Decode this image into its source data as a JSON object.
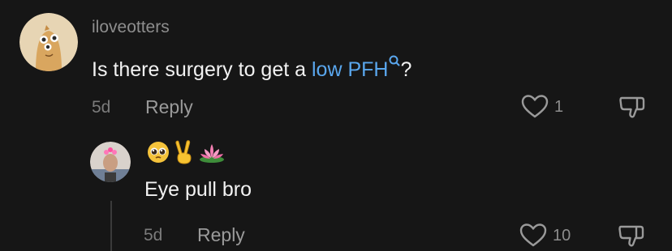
{
  "comment": {
    "username": "iloveotters",
    "text_before": "Is there surgery to get a ",
    "link_text": "low PFH",
    "text_after": "?",
    "time": "5d",
    "reply_label": "Reply",
    "like_count": "1"
  },
  "reply": {
    "emoji": [
      "pleading-face",
      "victory-hand",
      "lotus"
    ],
    "text": "Eye pull bro",
    "time": "5d",
    "reply_label": "Reply",
    "like_count": "10"
  },
  "colors": {
    "background": "#161616",
    "link": "#5aa7ee",
    "muted": "#8d8d8d"
  }
}
